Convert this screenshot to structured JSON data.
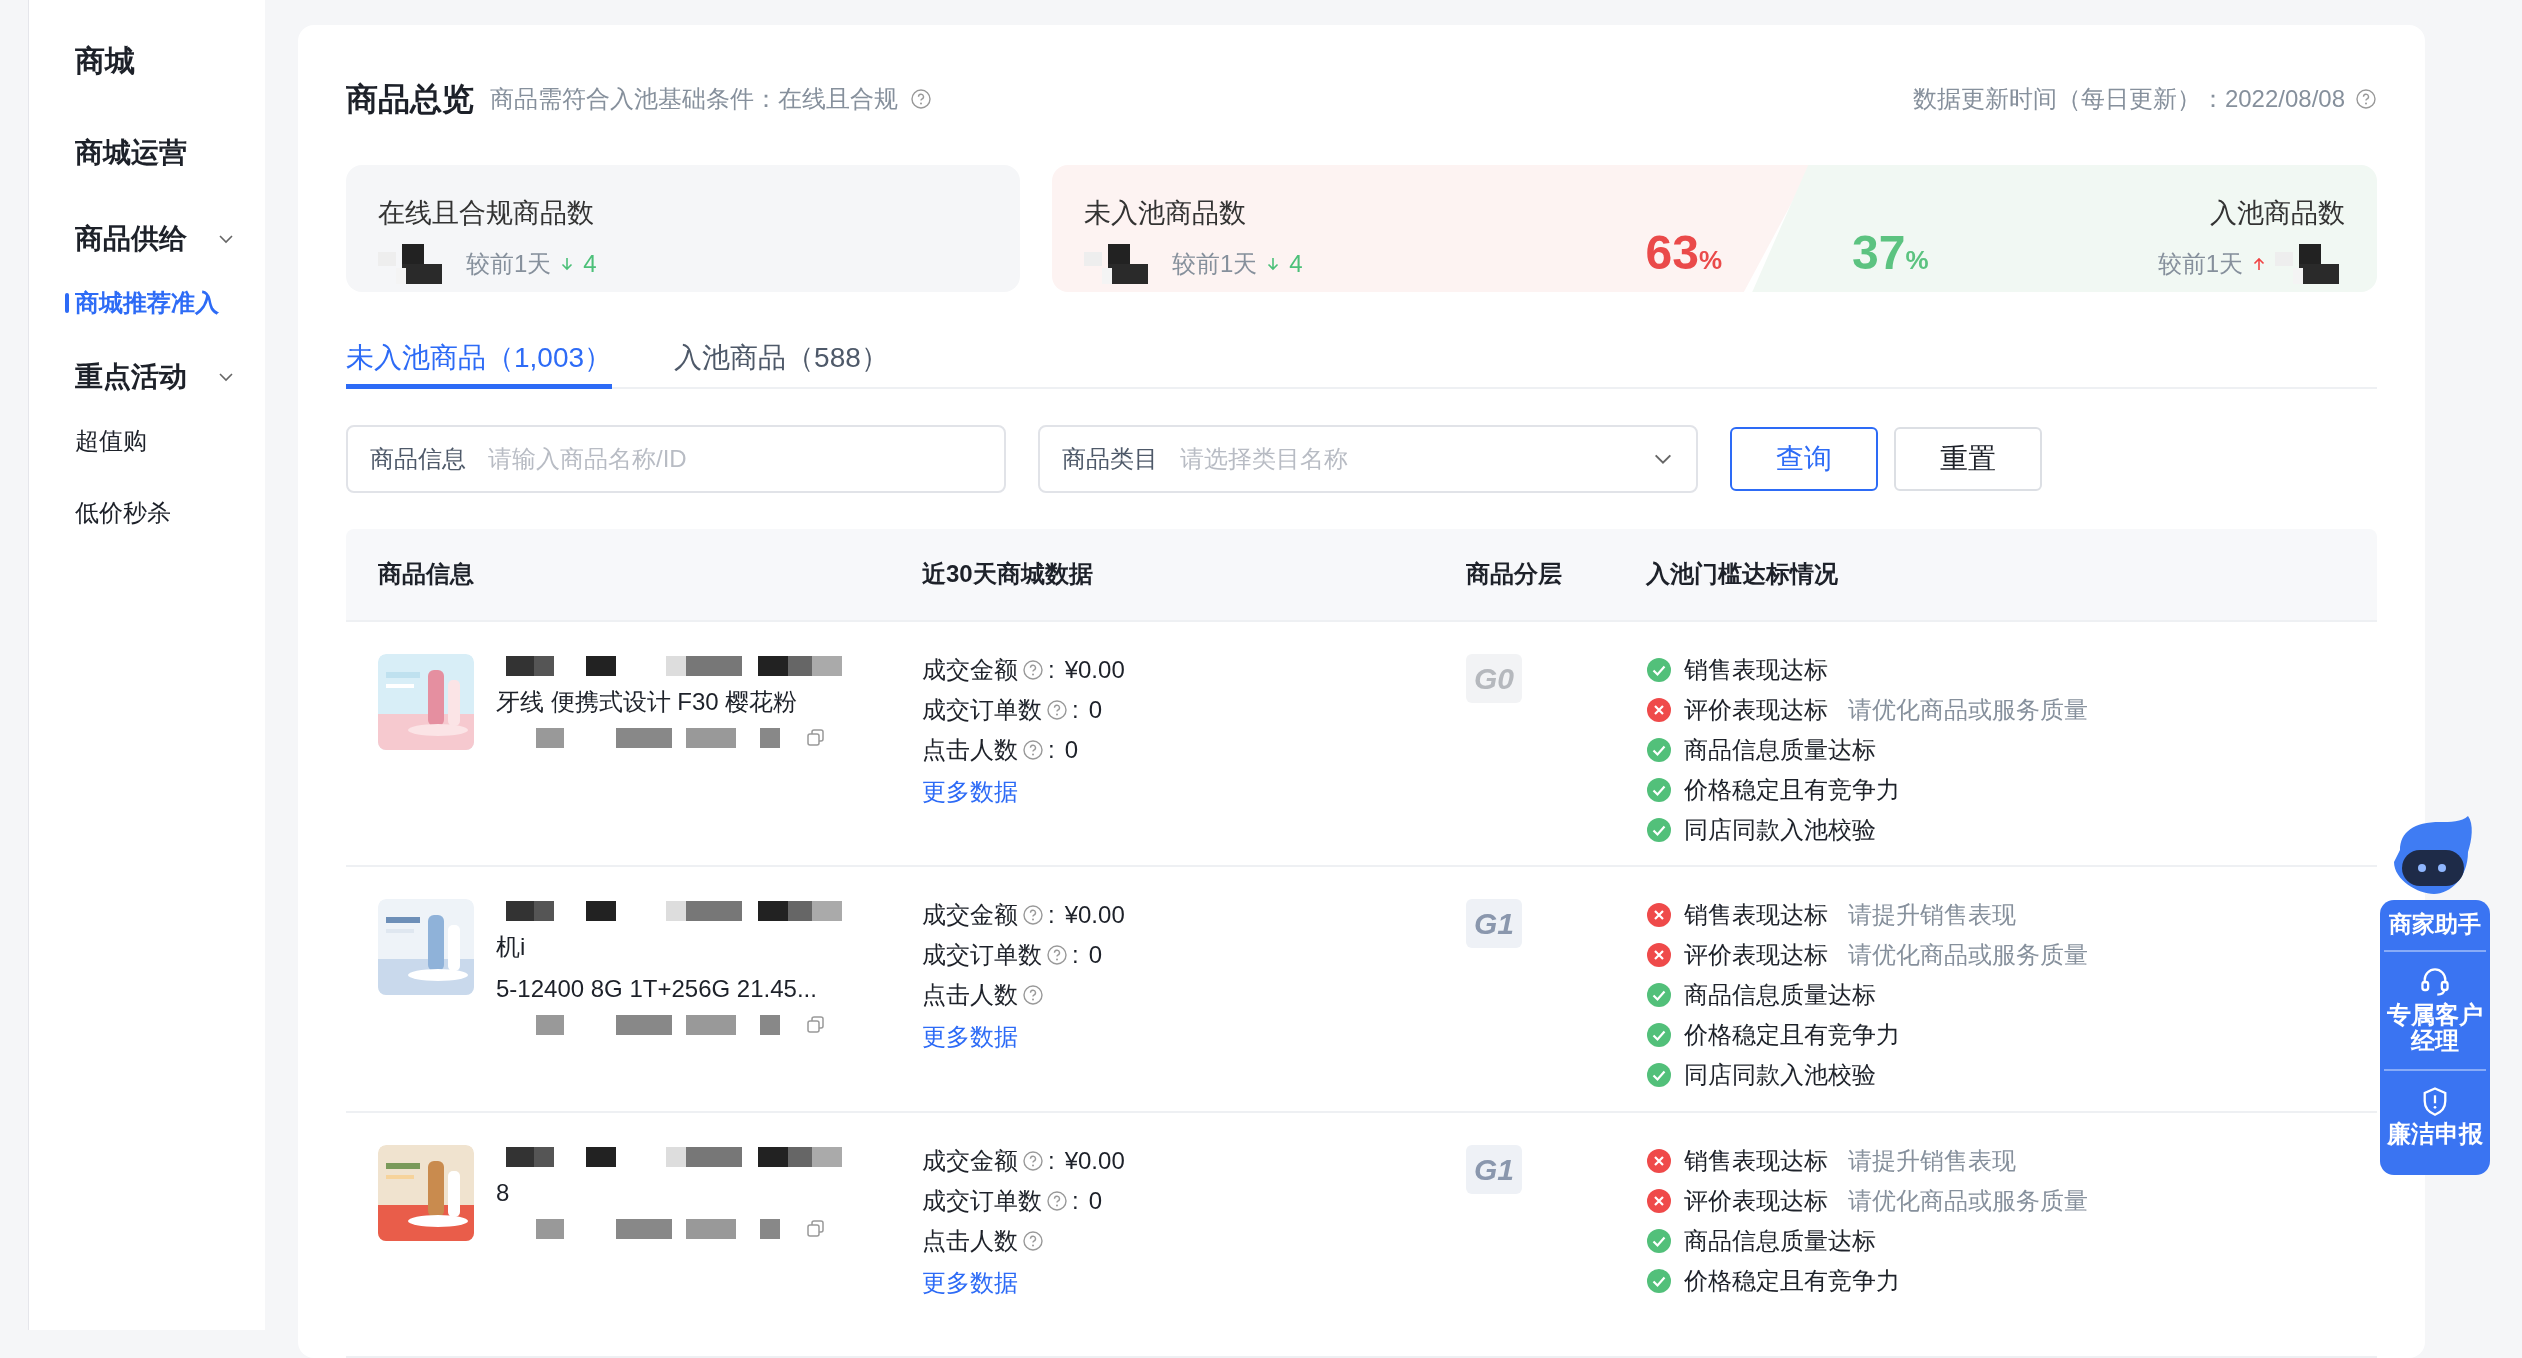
{
  "sidebar": {
    "title": "商城",
    "items": [
      {
        "label": "商城运营"
      },
      {
        "label": "商品供给",
        "children": [
          {
            "label": "商城推荐准入",
            "selected": true
          }
        ]
      },
      {
        "label": "重点活动",
        "children": [
          {
            "label": "超值购",
            "selected": false
          },
          {
            "label": "低价秒杀",
            "selected": false
          }
        ]
      }
    ]
  },
  "overview": {
    "title": "商品总览",
    "subtitle": "商品需符合入池基础条件：在线且合规",
    "update_time": "数据更新时间（每日更新）：2022/08/08"
  },
  "stats": [
    {
      "kind": "plain",
      "label": "在线且合规商品数",
      "compare": "较前1天",
      "rising": false,
      "delta": "4"
    },
    {
      "kind": "left",
      "label": "未入池商品数",
      "compare": "较前1天",
      "rising": false,
      "delta": "4",
      "percent": "63",
      "unit": "%"
    },
    {
      "kind": "right",
      "label": "入池商品数",
      "compare": "较前1天",
      "rising": true,
      "percent": "37",
      "unit": "%"
    }
  ],
  "tabs": [
    {
      "label": "未入池商品（1,003）",
      "selected": true
    },
    {
      "label": "入池商品（588）",
      "selected": false
    }
  ],
  "filters": [
    {
      "kind": "text",
      "label": "商品信息",
      "placeholder": "请输入商品名称/ID"
    },
    {
      "kind": "select",
      "label": "商品类目",
      "placeholder": "请选择类目名称"
    }
  ],
  "buttons": [
    {
      "label": "查询",
      "primary": true
    },
    {
      "label": "重置",
      "primary": false
    }
  ],
  "table": {
    "columns": [
      "商品信息",
      "近30天商城数据",
      "商品分层",
      "入池门槛达标情况"
    ],
    "rows": [
      {
        "name_lines": [
          "牙线 便携式设计 F30 樱花粉"
        ],
        "metrics": [
          {
            "label": "成交金额",
            "sep": ":",
            "value": "¥0.00"
          },
          {
            "label": "成交订单数",
            "sep": ":",
            "value": "0"
          },
          {
            "label": "点击人数",
            "sep": ":",
            "value": "0"
          }
        ],
        "more": "更多数据",
        "tier": "G0",
        "checks": [
          {
            "label": "销售表现达标",
            "passed": true
          },
          {
            "label": "评价表现达标",
            "passed": false,
            "hint": "请优化商品或服务质量"
          },
          {
            "label": "商品信息质量达标",
            "passed": true
          },
          {
            "label": "价格稳定且有竞争力",
            "passed": true
          },
          {
            "label": "同店同款入池校验",
            "passed": true
          }
        ]
      },
      {
        "name_lines": [
          "机i",
          "5-12400 8G 1T+256G 21.45..."
        ],
        "metrics": [
          {
            "label": "成交金额",
            "sep": ":",
            "value": "¥0.00"
          },
          {
            "label": "成交订单数",
            "sep": ":",
            "value": "0"
          },
          {
            "label": "点击人数"
          }
        ],
        "more": "更多数据",
        "tier": "G1",
        "checks": [
          {
            "label": "销售表现达标",
            "passed": false,
            "hint": "请提升销售表现"
          },
          {
            "label": "评价表现达标",
            "passed": false,
            "hint": "请优化商品或服务质量"
          },
          {
            "label": "商品信息质量达标",
            "passed": true
          },
          {
            "label": "价格稳定且有竞争力",
            "passed": true
          },
          {
            "label": "同店同款入池校验",
            "passed": true
          }
        ]
      },
      {
        "name_lines": [
          "8"
        ],
        "metrics": [
          {
            "label": "成交金额",
            "sep": ":",
            "value": "¥0.00"
          },
          {
            "label": "成交订单数",
            "sep": ":",
            "value": "0"
          },
          {
            "label": "点击人数"
          }
        ],
        "more": "更多数据",
        "tier": "G1",
        "checks": [
          {
            "label": "销售表现达标",
            "passed": false,
            "hint": "请提升销售表现"
          },
          {
            "label": "评价表现达标",
            "passed": false,
            "hint": "请优化商品或服务质量"
          },
          {
            "label": "商品信息质量达标",
            "passed": true
          },
          {
            "label": "价格稳定且有竞争力",
            "passed": true
          }
        ]
      }
    ]
  },
  "float_panel": {
    "title": "商家助手",
    "items": [
      {
        "kind": "headset",
        "label": "专属客户经理"
      },
      {
        "kind": "shield",
        "label": "廉洁申报"
      }
    ]
  }
}
